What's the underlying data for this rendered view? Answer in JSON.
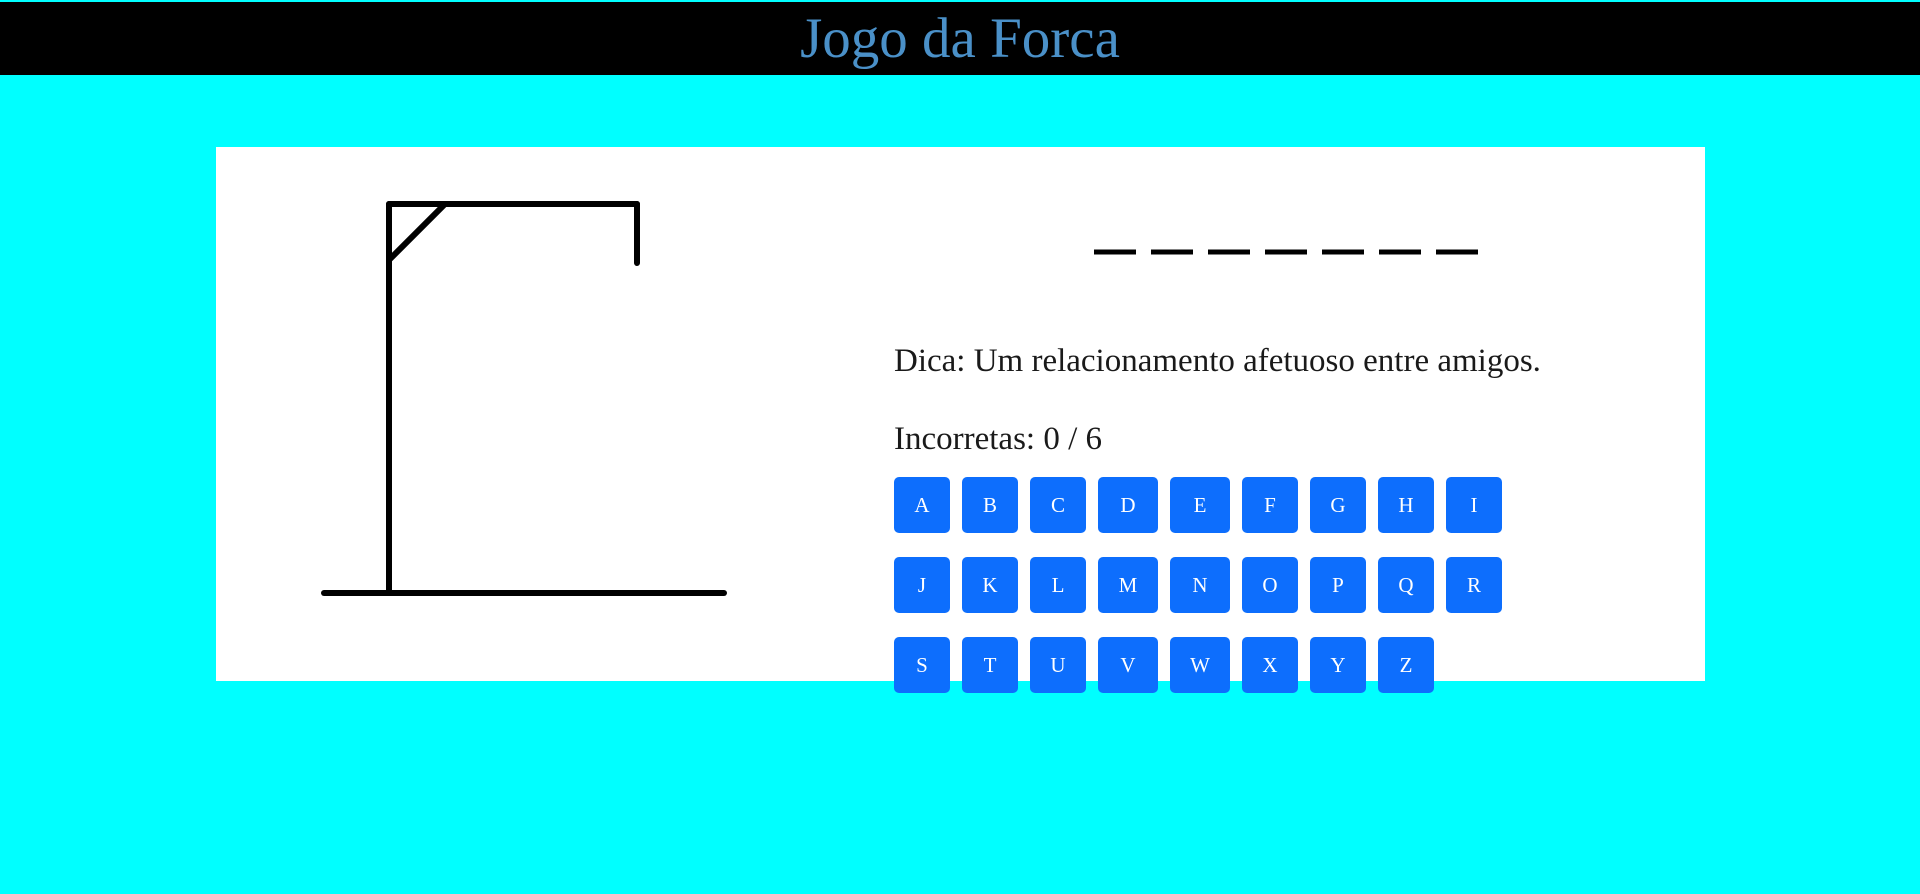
{
  "header": {
    "title": "Jogo da Forca"
  },
  "game": {
    "hint": "Dica: Um relacionamento afetuoso entre amigos.",
    "wrong_label": "Incorretas: 0 / 6",
    "wrong_guesses": 0,
    "max_wrong": 6,
    "word_length": 7
  },
  "keyboard": {
    "rows": [
      [
        "A",
        "B",
        "C",
        "D",
        "E",
        "F",
        "G",
        "H",
        "I"
      ],
      [
        "J",
        "K",
        "L",
        "M",
        "N",
        "O",
        "P",
        "Q",
        "R"
      ],
      [
        "S",
        "T",
        "U",
        "V",
        "W",
        "X",
        "Y",
        "Z"
      ]
    ]
  },
  "colors": {
    "page_background": "#00ffff",
    "header_background": "#000000",
    "title_color": "#4a90c8",
    "key_background": "#0d6efd",
    "key_text": "#ffffff"
  }
}
